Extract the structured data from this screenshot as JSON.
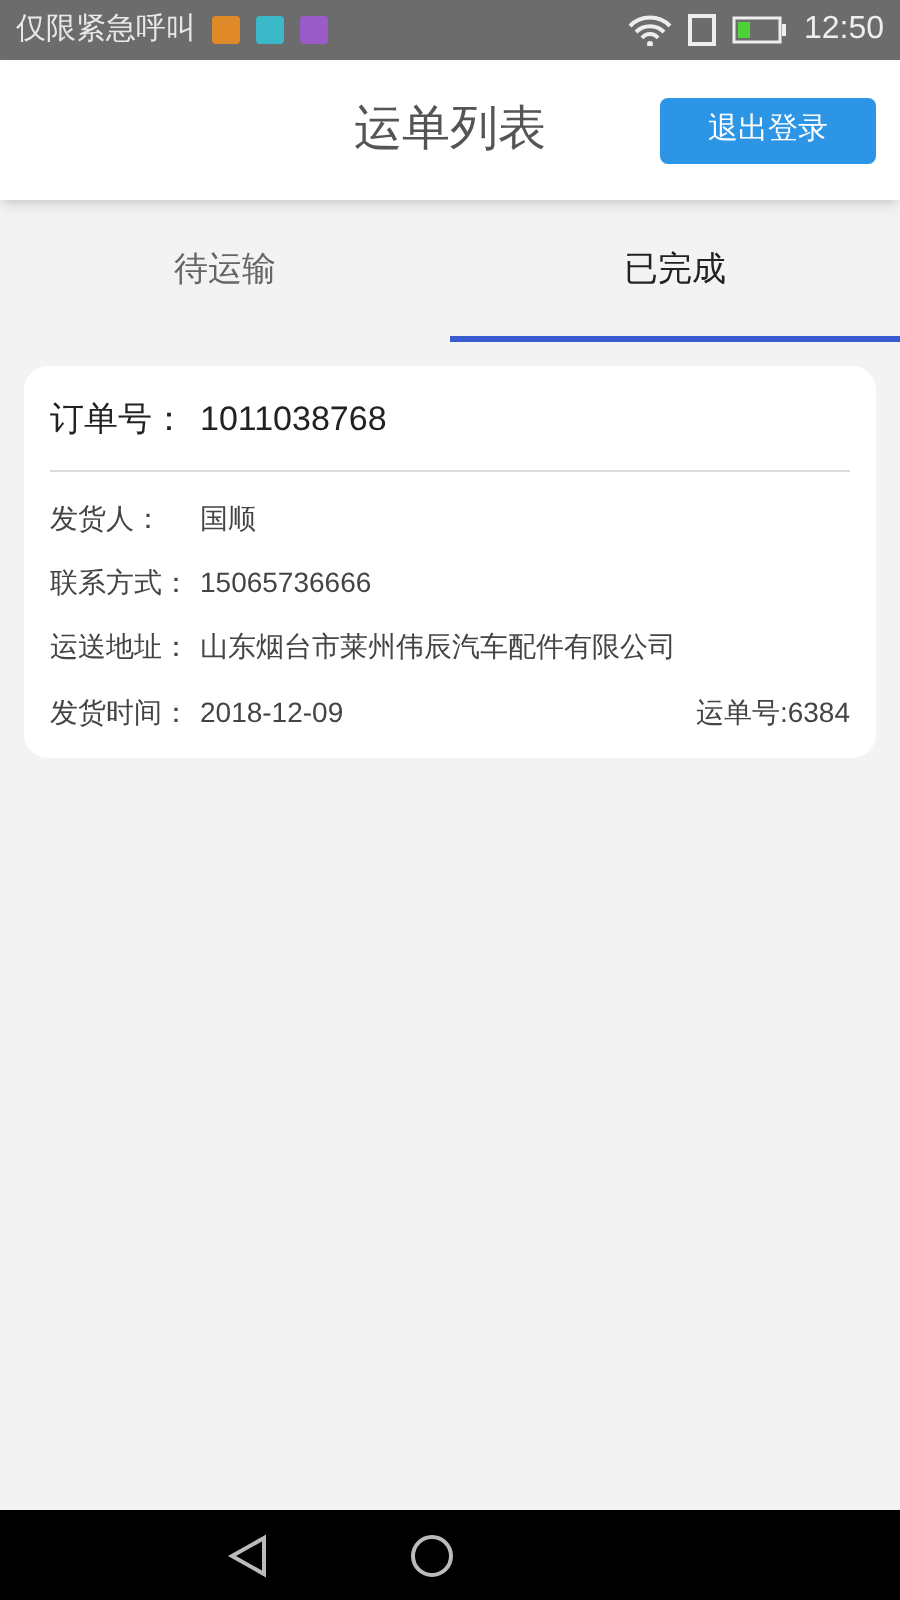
{
  "status_bar": {
    "carrier": "仅限紧急呼叫",
    "time": "12:50"
  },
  "header": {
    "title": "运单列表",
    "logout_button": "退出登录"
  },
  "tabs": [
    {
      "label": "待运输",
      "selected": false
    },
    {
      "label": "已完成",
      "selected": true
    }
  ],
  "orders": [
    {
      "order_label": "订单号：",
      "order_number": "1011038768",
      "fields": [
        {
          "label": "发货人：",
          "value": "国顺"
        },
        {
          "label": "联系方式：",
          "value": "15065736666"
        },
        {
          "label": "运送地址：",
          "value": "山东烟台市莱州伟辰汽车配件有限公司"
        }
      ],
      "date_label": "发货时间：",
      "date": "2018-12-09",
      "waybill": "运单号:6384"
    }
  ]
}
